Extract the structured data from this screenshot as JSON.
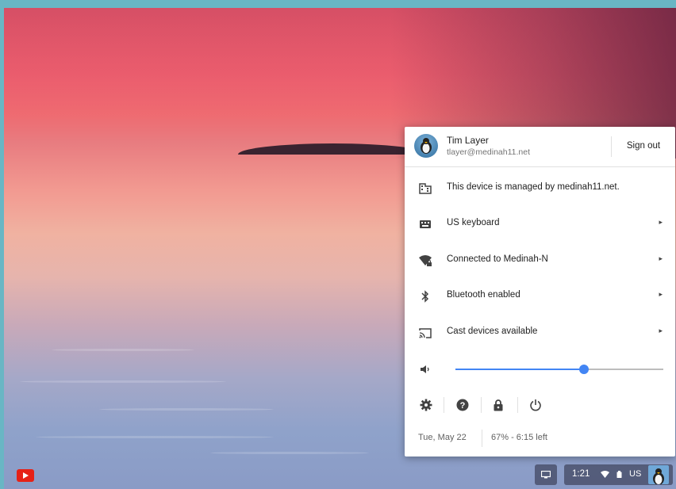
{
  "user": {
    "name": "Tim Layer",
    "email": "tlayer@medinah11.net",
    "sign_out": "Sign out"
  },
  "menu": [
    {
      "icon": "building-icon",
      "label": "This device is managed by medinah11.net.",
      "has_arrow": false
    },
    {
      "icon": "keyboard-icon",
      "label": "US keyboard",
      "has_arrow": true
    },
    {
      "icon": "wifi-icon",
      "label": "Connected to Medinah-N",
      "has_arrow": true
    },
    {
      "icon": "bluetooth-icon",
      "label": "Bluetooth enabled",
      "has_arrow": true
    },
    {
      "icon": "cast-icon",
      "label": "Cast devices available",
      "has_arrow": true
    }
  ],
  "volume": {
    "icon": "volume-icon",
    "level": 0.62
  },
  "actions": [
    "settings-icon",
    "help-icon",
    "lock-icon",
    "power-icon"
  ],
  "status": {
    "date": "Tue, May 22",
    "battery": "67% - 6:15 left"
  },
  "shelf": {
    "time": "1:21",
    "keyboard": "US",
    "accent": "#4285f4"
  }
}
